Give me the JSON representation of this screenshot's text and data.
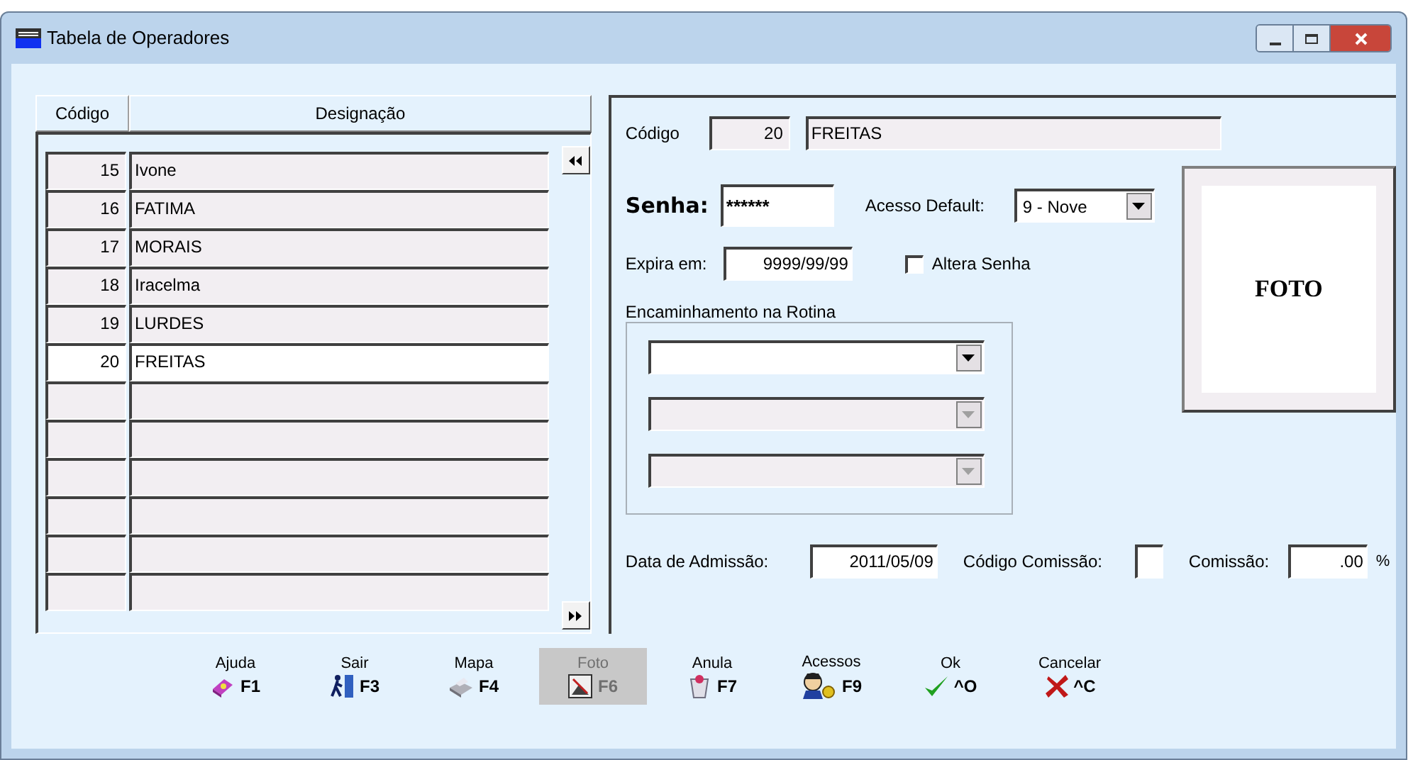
{
  "window": {
    "title": "Tabela de Operadores"
  },
  "table": {
    "columns": [
      "Código",
      "Designação"
    ],
    "rows": [
      {
        "code": "15",
        "name": "Ivone",
        "selected": false
      },
      {
        "code": "16",
        "name": "FATIMA",
        "selected": false
      },
      {
        "code": "17",
        "name": "MORAIS",
        "selected": false
      },
      {
        "code": "18",
        "name": "Iracelma",
        "selected": false
      },
      {
        "code": "19",
        "name": "LURDES",
        "selected": false
      },
      {
        "code": "20",
        "name": "FREITAS",
        "selected": true
      }
    ]
  },
  "form": {
    "codigo_label": "Código",
    "codigo": "20",
    "nome": "FREITAS",
    "senha_label": "Senha:",
    "senha": "******",
    "acesso_label": "Acesso Default:",
    "acesso": "9 - Nove",
    "expira_label": "Expira em:",
    "expira": "9999/99/99",
    "altera_senha": {
      "label": "Altera Senha",
      "checked": false
    },
    "photo_label": "FOTO",
    "group_label": "Encaminhamento na Rotina",
    "routing_selects": [
      {
        "disabled": false
      },
      {
        "disabled": true
      },
      {
        "disabled": true
      }
    ],
    "admissao_label": "Data de Admissão:",
    "admissao": "2011/05/09",
    "cod_comissao_label": "Código Comissão:",
    "comissao_label": "Comissão:",
    "comissao": ".00",
    "percent": "%"
  },
  "toolbar": [
    {
      "label": "Ajuda",
      "key": "F1",
      "kind": "book",
      "disabled": false
    },
    {
      "label": "Sair",
      "key": "F3",
      "kind": "exit",
      "disabled": false
    },
    {
      "label": "Mapa",
      "key": "F4",
      "kind": "printer",
      "disabled": false
    },
    {
      "label": "Foto",
      "key": "F6",
      "kind": "photo",
      "disabled": true
    },
    {
      "label": "Anula",
      "key": "F7",
      "kind": "trash",
      "disabled": false
    },
    {
      "label": "Acessos",
      "key": "F9",
      "kind": "keyman",
      "disabled": false
    },
    {
      "label": "Ok",
      "key": "^O",
      "kind": "check",
      "disabled": false
    },
    {
      "label": "Cancelar",
      "key": "^C",
      "kind": "cross",
      "disabled": false
    }
  ]
}
